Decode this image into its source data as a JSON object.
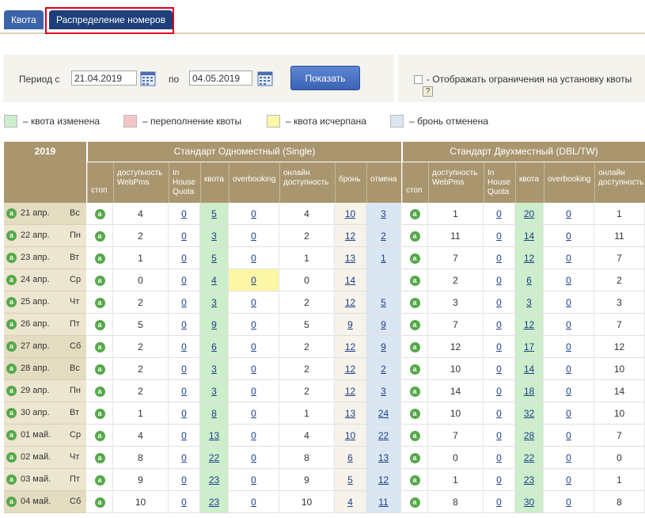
{
  "tabs": [
    {
      "label": "Квота"
    },
    {
      "label": "Распределение номеров"
    }
  ],
  "filter": {
    "period_label": "Период  с",
    "date_from": "21.04.2019",
    "to_label": "по",
    "date_to": "04.05.2019",
    "show_button": "Показать",
    "restriction_label": "- Отображать ограничения на установку квоты",
    "help_text": "?"
  },
  "legend": [
    {
      "color": "#cdeecb",
      "label": "– квота изменена"
    },
    {
      "color": "#f5c6c6",
      "label": "– переполнение квоты"
    },
    {
      "color": "#fbf7a6",
      "label": "– квота исчерпана"
    },
    {
      "color": "#dbe6f3",
      "label": "– бронь отменена"
    }
  ],
  "table": {
    "year": "2019",
    "room_types": [
      {
        "name": "Стандарт Одноместный (Single)"
      },
      {
        "name": "Стандарт Двухместный (DBL/TW)"
      }
    ],
    "columns": [
      "стоп",
      "доступность WebPms",
      "In House Quota",
      "квота",
      "overbooking",
      "онлайн доступность",
      "бронь",
      "отмена"
    ],
    "stop_icon_letter": "a",
    "rows": [
      {
        "date": "21 апр.",
        "dow": "Вс",
        "weekend": true,
        "s": [
          "4",
          "0",
          "5",
          "0",
          "4",
          "10",
          "3"
        ],
        "d": [
          "1",
          "0",
          "20",
          "0",
          "1"
        ]
      },
      {
        "date": "22 апр.",
        "dow": "Пн",
        "weekend": false,
        "s": [
          "2",
          "0",
          "3",
          "0",
          "2",
          "12",
          "2"
        ],
        "d": [
          "11",
          "0",
          "14",
          "0",
          "11"
        ]
      },
      {
        "date": "23 апр.",
        "dow": "Вт",
        "weekend": false,
        "s": [
          "1",
          "0",
          "5",
          "0",
          "1",
          "13",
          "1"
        ],
        "d": [
          "7",
          "0",
          "12",
          "0",
          "7"
        ]
      },
      {
        "date": "24 апр.",
        "dow": "Ср",
        "weekend": false,
        "s": [
          "0",
          "0",
          "4",
          "0",
          "0",
          "14",
          ""
        ],
        "d": [
          "2",
          "0",
          "6",
          "0",
          "2"
        ],
        "s_overbooking_yellow": true
      },
      {
        "date": "25 апр.",
        "dow": "Чт",
        "weekend": false,
        "s": [
          "2",
          "0",
          "3",
          "0",
          "2",
          "12",
          "5"
        ],
        "d": [
          "3",
          "0",
          "3",
          "0",
          "3"
        ]
      },
      {
        "date": "26 апр.",
        "dow": "Пт",
        "weekend": false,
        "s": [
          "5",
          "0",
          "9",
          "0",
          "5",
          "9",
          "9"
        ],
        "d": [
          "7",
          "0",
          "12",
          "0",
          "7"
        ]
      },
      {
        "date": "27 апр.",
        "dow": "Сб",
        "weekend": true,
        "s": [
          "2",
          "0",
          "6",
          "0",
          "2",
          "12",
          "9"
        ],
        "d": [
          "12",
          "0",
          "17",
          "0",
          "12"
        ]
      },
      {
        "date": "28 апр.",
        "dow": "Вс",
        "weekend": true,
        "s": [
          "2",
          "0",
          "3",
          "0",
          "2",
          "12",
          "2"
        ],
        "d": [
          "10",
          "0",
          "14",
          "0",
          "10"
        ]
      },
      {
        "date": "29 апр.",
        "dow": "Пн",
        "weekend": false,
        "s": [
          "2",
          "0",
          "3",
          "0",
          "2",
          "12",
          "3"
        ],
        "d": [
          "14",
          "0",
          "18",
          "0",
          "14"
        ]
      },
      {
        "date": "30 апр.",
        "dow": "Вт",
        "weekend": false,
        "s": [
          "1",
          "0",
          "8",
          "0",
          "1",
          "13",
          "24"
        ],
        "d": [
          "10",
          "0",
          "32",
          "0",
          "10"
        ]
      },
      {
        "date": "01 май.",
        "dow": "Ср",
        "weekend": false,
        "s": [
          "4",
          "0",
          "13",
          "0",
          "4",
          "10",
          "22"
        ],
        "d": [
          "7",
          "0",
          "28",
          "0",
          "7"
        ]
      },
      {
        "date": "02 май.",
        "dow": "Чт",
        "weekend": false,
        "s": [
          "8",
          "0",
          "22",
          "0",
          "8",
          "6",
          "13"
        ],
        "d": [
          "0",
          "0",
          "22",
          "0",
          "0"
        ]
      },
      {
        "date": "03 май.",
        "dow": "Пт",
        "weekend": false,
        "s": [
          "9",
          "0",
          "23",
          "0",
          "9",
          "5",
          "12"
        ],
        "d": [
          "1",
          "0",
          "23",
          "0",
          "1"
        ]
      },
      {
        "date": "04 май.",
        "dow": "Сб",
        "weekend": true,
        "s": [
          "10",
          "0",
          "23",
          "0",
          "10",
          "4",
          "11"
        ],
        "d": [
          "8",
          "0",
          "30",
          "0",
          "8"
        ]
      }
    ]
  },
  "colors": {
    "header_bg": "#a9966f",
    "quota_changed": "#cdeecb",
    "cancel_bg": "#dbe6f3",
    "booking_bg": "#f7f3ea",
    "overbooking_yellow": "#fbf7a6"
  }
}
